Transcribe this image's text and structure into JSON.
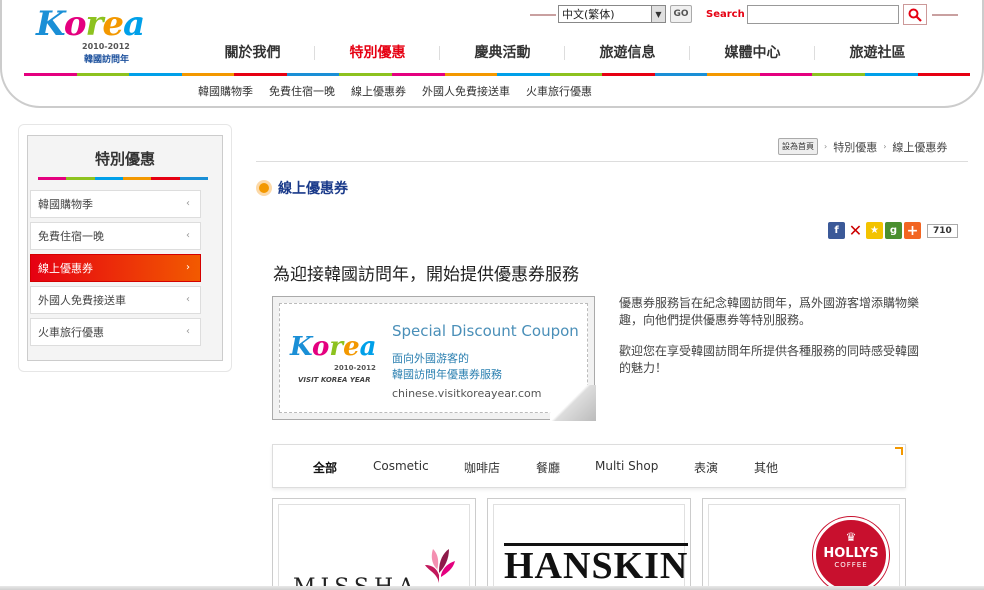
{
  "logo": {
    "letters": [
      "K",
      "o",
      "r",
      "e",
      "a"
    ],
    "year": "2010-2012",
    "subtitle": "韓國訪問年"
  },
  "header": {
    "language_selected": "中文(繁体)",
    "go_label": "GO",
    "search_label": "Search",
    "search_placeholder": "",
    "nav": [
      {
        "label": "關於我們"
      },
      {
        "label": "特別優惠"
      },
      {
        "label": "慶典活動"
      },
      {
        "label": "旅遊信息"
      },
      {
        "label": "媒體中心"
      },
      {
        "label": "旅遊社區"
      }
    ],
    "active_nav": 1,
    "color_bar": [
      "#e4007f",
      "#8dc21f",
      "#00a0e9",
      "#f39800",
      "#e60012",
      "#1a8fd6",
      "#8dc21f",
      "#e4007f",
      "#f39800",
      "#00a0e9",
      "#8dc21f",
      "#e60012",
      "#1a8fd6",
      "#f39800",
      "#e4007f",
      "#8dc21f",
      "#00a0e9",
      "#e60012"
    ],
    "sub_nav": [
      {
        "label": "韓國購物季"
      },
      {
        "label": "免費住宿一晚"
      },
      {
        "label": "線上優惠券"
      },
      {
        "label": "外國人免費接送車"
      },
      {
        "label": "火車旅行優惠"
      }
    ]
  },
  "sidebar": {
    "title": "特別優惠",
    "color_bar": [
      "#e4007f",
      "#8dc21f",
      "#00a0e9",
      "#f39800",
      "#e60012",
      "#1a8fd6"
    ],
    "items": [
      {
        "label": "韓國購物季",
        "chevron": "‹"
      },
      {
        "label": "免費住宿一晚",
        "chevron": "‹"
      },
      {
        "label": "線上優惠券",
        "chevron": "›"
      },
      {
        "label": "外國人免費接送車",
        "chevron": "‹"
      },
      {
        "label": "火車旅行優惠",
        "chevron": "‹"
      }
    ],
    "active_index": 2
  },
  "breadcrumb": {
    "home": "設為首頁",
    "items": [
      "特別優惠",
      "線上優惠券"
    ]
  },
  "page": {
    "title": "線上優惠券",
    "share_count": "710",
    "headline": "為迎接韓國訪問年，開始提供優惠券服務",
    "desc1": "優惠券服務旨在紀念韓國訪問年，爲外國游客增添購物樂趣，向他們提供優惠券等特別服務。",
    "desc2": "歡迎您在享受韓國訪問年所提供各種服務的同時感受韓國的魅力！"
  },
  "coupon": {
    "heading": "Special Discount Coupon",
    "line1": "面向外國游客的",
    "line2": "韓國訪問年優惠券服務",
    "url": "chinese.visitkoreayear.com",
    "logo_year": "2010-2012",
    "logo_caption": "VISIT KOREA YEAR"
  },
  "categories": [
    {
      "label": "全部"
    },
    {
      "label": "Cosmetic"
    },
    {
      "label": "咖啡店"
    },
    {
      "label": "餐廳"
    },
    {
      "label": "Multi Shop"
    },
    {
      "label": "表演"
    },
    {
      "label": "其他"
    }
  ],
  "active_category": 0,
  "brands": [
    {
      "name": "MISSHA"
    },
    {
      "name": "HANSKIN"
    },
    {
      "name": "HOLLYS",
      "sub": "COFFEE"
    }
  ],
  "colors": {
    "accent_red": "#e60012",
    "title_blue": "#1a3a8a"
  }
}
